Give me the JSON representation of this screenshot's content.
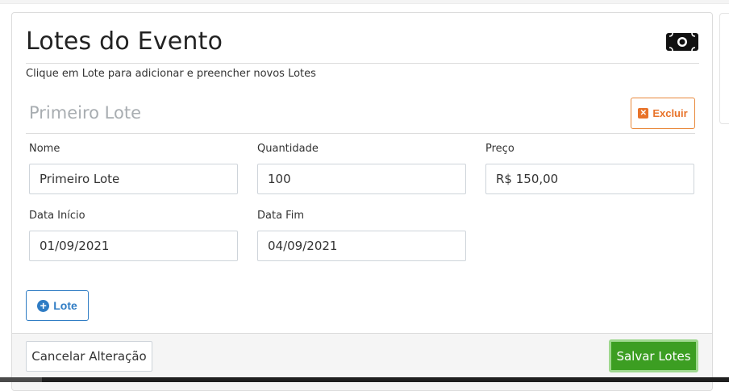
{
  "card": {
    "title": "Lotes do Evento",
    "subtitle": "Clique em Lote para adicionar e preencher novos Lotes",
    "icon": "money-bill-icon"
  },
  "lote": {
    "heading": "Primeiro Lote",
    "delete_label": "Excluir",
    "fields": {
      "nome": {
        "label": "Nome",
        "value": "Primeiro Lote"
      },
      "quantidade": {
        "label": "Quantidade",
        "value": "100"
      },
      "preco": {
        "label": "Preço",
        "value": "R$ 150,00"
      },
      "data_inicio": {
        "label": "Data Início",
        "value": "01/09/2021"
      },
      "data_fim": {
        "label": "Data Fim",
        "value": "04/09/2021"
      }
    }
  },
  "actions": {
    "add_lote_label": "Lote",
    "cancel_label": "Cancelar Alteração",
    "save_label": "Salvar Lotes"
  },
  "colors": {
    "primary": "#2f7cc4",
    "warning": "#e8732a",
    "success": "#3c9e22"
  }
}
